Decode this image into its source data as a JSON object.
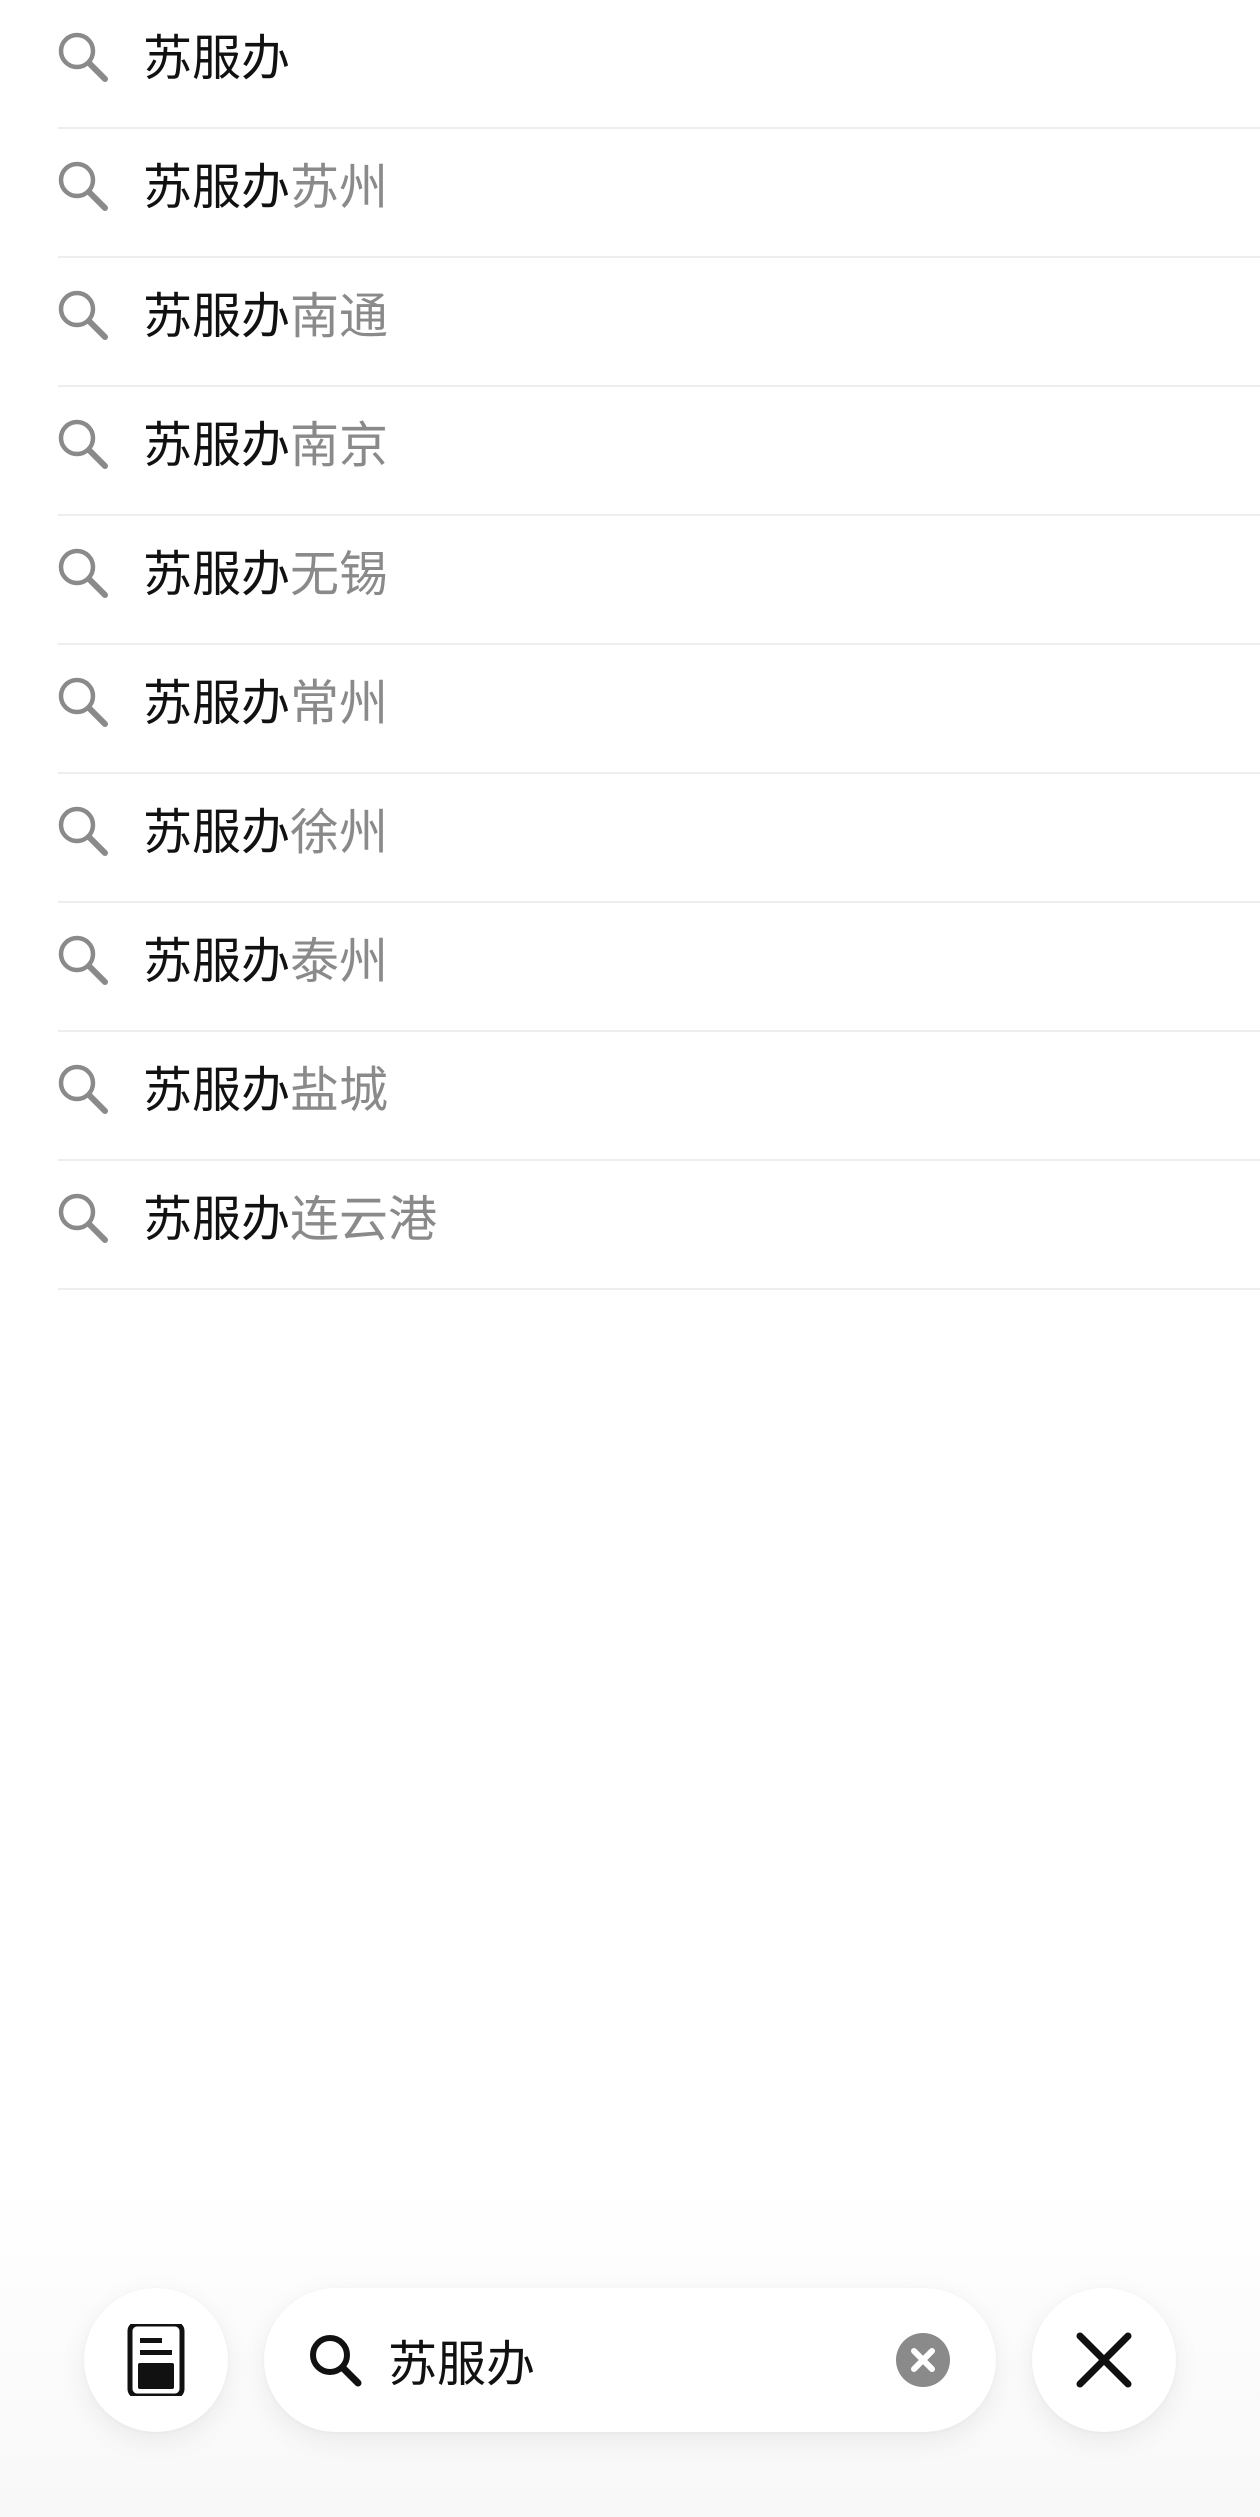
{
  "suggestions": [
    {
      "query": "苏服办",
      "suffix": ""
    },
    {
      "query": "苏服办",
      "suffix": "苏州"
    },
    {
      "query": "苏服办",
      "suffix": "南通"
    },
    {
      "query": "苏服办",
      "suffix": "南京"
    },
    {
      "query": "苏服办",
      "suffix": "无锡"
    },
    {
      "query": "苏服办",
      "suffix": "常州"
    },
    {
      "query": "苏服办",
      "suffix": "徐州"
    },
    {
      "query": "苏服办",
      "suffix": "泰州"
    },
    {
      "query": "苏服办",
      "suffix": "盐城"
    },
    {
      "query": "苏服办",
      "suffix": "连云港"
    }
  ],
  "bottom_bar": {
    "search_value": "苏服办",
    "tab_icon": "tab-switcher-icon",
    "search_icon": "search-icon",
    "clear_icon": "clear-icon",
    "close_icon": "close-icon"
  },
  "colors": {
    "query_text": "#111111",
    "suffix_text": "#8a8a8a",
    "row_icon": "#8a8a8a",
    "divider": "#eeeeee",
    "clear_icon_bg": "#8a8a8a"
  }
}
